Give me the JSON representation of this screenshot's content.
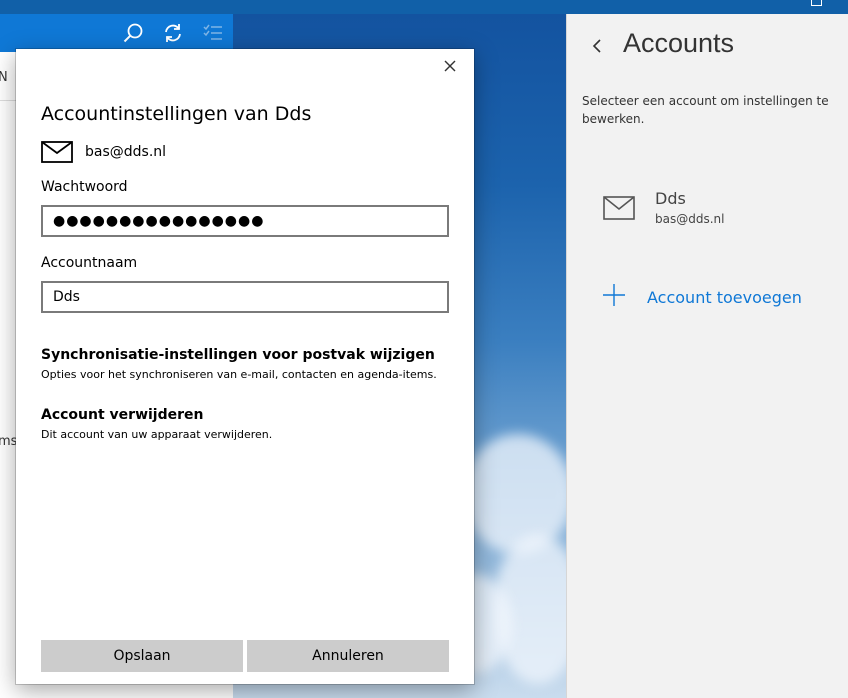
{
  "mail_background": {
    "fragment_top": "N",
    "fragment_mid": "ms"
  },
  "accounts_pane": {
    "back_icon": "chevron-left-icon",
    "title": "Accounts",
    "description": "Selecteer een account om instellingen te bewerken.",
    "account": {
      "name": "Dds",
      "email": "bas@dds.nl",
      "icon": "envelope-icon"
    },
    "add_label": "Account toevoegen",
    "accent_color": "#0f78d6"
  },
  "dialog": {
    "title": "Accountinstellingen van Dds",
    "email": "bas@dds.nl",
    "password_label": "Wachtwoord",
    "password_value": "●●●●●●●●●●●●●●●●",
    "account_name_label": "Accountnaam",
    "account_name_value": "Dds",
    "sync_title": "Synchronisatie-instellingen voor postvak wijzigen",
    "sync_desc": "Opties voor het synchroniseren van e-mail, contacten en agenda-items.",
    "remove_title": "Account verwijderen",
    "remove_desc": "Dit account van uw apparaat verwijderen.",
    "save_label": "Opslaan",
    "cancel_label": "Annuleren"
  }
}
